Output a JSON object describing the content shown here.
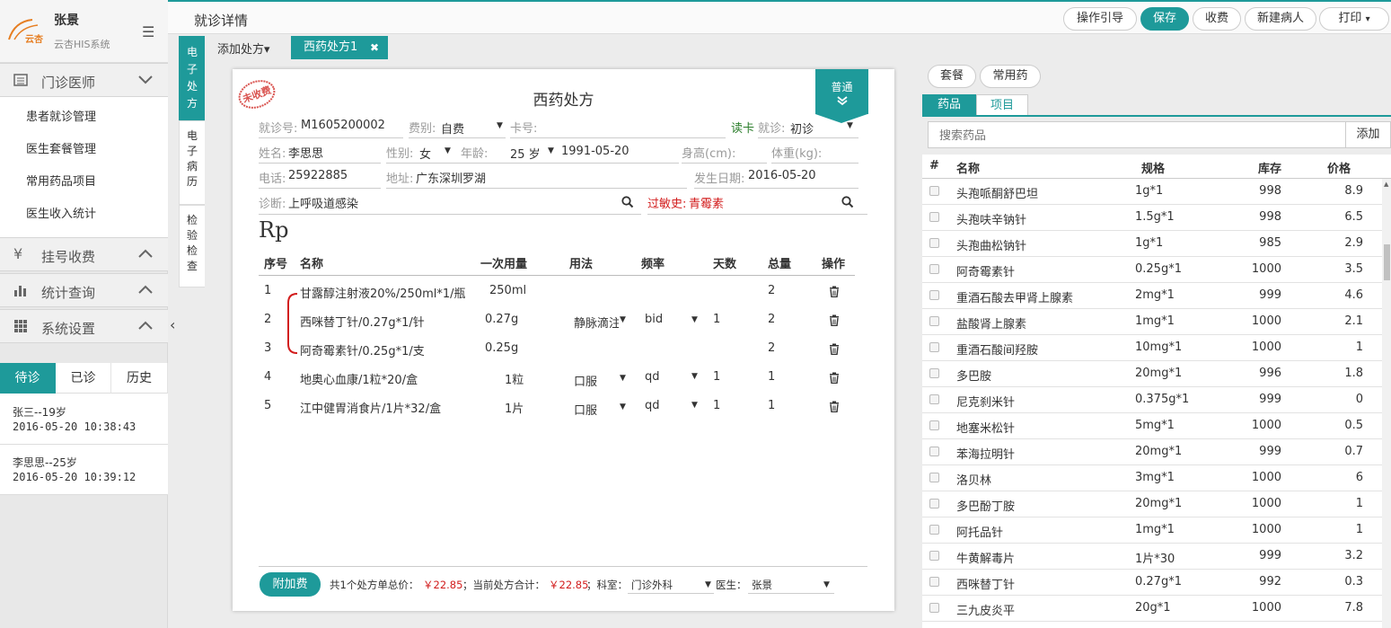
{
  "brand": {
    "user": "张景",
    "system": "云杏HIS系统",
    "logo_text": "云杏"
  },
  "nav": {
    "sections": [
      {
        "label": "门诊医师",
        "icon": "list-icon",
        "expanded": true
      },
      {
        "label": "挂号收费",
        "icon": "yen-icon",
        "expanded": false
      },
      {
        "label": "统计查询",
        "icon": "bar-chart-icon",
        "expanded": false
      },
      {
        "label": "系统设置",
        "icon": "grid-icon",
        "expanded": false
      }
    ],
    "items": [
      "患者就诊管理",
      "医生套餐管理",
      "常用药品项目",
      "医生收入统计"
    ]
  },
  "queue": {
    "tabs": [
      "待诊",
      "已诊",
      "历史"
    ],
    "patients": [
      {
        "name": "张三--19岁",
        "time": "2016-05-20 10:38:43"
      },
      {
        "name": "李思思--25岁",
        "time": "2016-05-20 10:39:12"
      }
    ]
  },
  "header": {
    "title": "就诊详情",
    "buttons": [
      "操作引导",
      "保存",
      "收费",
      "新建病人",
      "打印"
    ],
    "print_caret": "▾"
  },
  "side_tabs": [
    "电子处方",
    "电子病历",
    "检验检查"
  ],
  "rx_tabs": {
    "add": "添加处方▾",
    "current": "西药处方1",
    "close": "✖"
  },
  "rx": {
    "title": "西药处方",
    "stamp": "未收费",
    "ribbon": "普通",
    "fields": {
      "visit_no_label": "就诊号:",
      "visit_no": "M1605200002",
      "fee_label": "费别:",
      "fee": "自费",
      "card_label": "卡号:",
      "read_card": "读卡",
      "visit_label": "就诊:",
      "visit": "初诊",
      "name_label": "姓名:",
      "name": "李思思",
      "sex_label": "性别:",
      "sex": "女",
      "age_label": "年龄:",
      "age": "25 岁",
      "birth": "1991-05-20",
      "height_label": "身高(cm):",
      "weight_label": "体重(kg):",
      "phone_label": "电话:",
      "phone": "25922885",
      "address_label": "地址:",
      "address": "广东深圳罗湖",
      "date_label": "发生日期:",
      "date": "2016-05-20",
      "diag_label": "诊断:",
      "diag": "上呼吸道感染",
      "allergy_label": "过敏史:",
      "allergy": "青霉素"
    },
    "rp": "Rp",
    "columns": [
      "序号",
      "名称",
      "一次用量",
      "用法",
      "频率",
      "天数",
      "总量",
      "操作"
    ],
    "rows": [
      {
        "no": "1",
        "name": "甘露醇注射液20%/250ml*1/瓶",
        "dose": "250ml",
        "usage": "",
        "freq": "",
        "days": "",
        "total": "2"
      },
      {
        "no": "2",
        "name": "西咪替丁针/0.27g*1/针",
        "dose": "0.27g",
        "usage": "静脉滴注",
        "freq": "bid",
        "days": "1",
        "total": "2"
      },
      {
        "no": "3",
        "name": "阿奇霉素针/0.25g*1/支",
        "dose": "0.25g",
        "usage": "",
        "freq": "",
        "days": "",
        "total": "2"
      },
      {
        "no": "4",
        "name": "地奥心血康/1粒*20/盒",
        "dose": "1粒",
        "usage": "口服",
        "freq": "qd",
        "days": "1",
        "total": "1"
      },
      {
        "no": "5",
        "name": "江中健胃消食片/1片*32/盒",
        "dose": "1片",
        "usage": "口服",
        "freq": "qd",
        "days": "1",
        "total": "1"
      }
    ],
    "footer": {
      "fee_button": "附加费",
      "summary_a": "共1个处方单总价：",
      "total_a": "￥22.85",
      "summary_b": "；当前处方合计：",
      "total_b": "￥22.85",
      "dept_label": "；科室：",
      "dept": "门诊外科",
      "doctor_label": "医生：",
      "doctor": "张景"
    }
  },
  "drugs": {
    "pills": [
      "套餐",
      "常用药"
    ],
    "tabs": [
      "药品",
      "项目"
    ],
    "search_placeholder": "搜索药品",
    "add": "添加",
    "columns": [
      "#",
      "名称",
      "规格",
      "库存",
      "价格"
    ],
    "rows": [
      {
        "name": "头孢哌酮舒巴坦",
        "spec": "1g*1",
        "stock": "998",
        "price": "8.9"
      },
      {
        "name": "头孢呋辛钠针",
        "spec": "1.5g*1",
        "stock": "998",
        "price": "6.5"
      },
      {
        "name": "头孢曲松钠针",
        "spec": "1g*1",
        "stock": "985",
        "price": "2.9"
      },
      {
        "name": "阿奇霉素针",
        "spec": "0.25g*1",
        "stock": "1000",
        "price": "3.5"
      },
      {
        "name": "重酒石酸去甲肾上腺素",
        "spec": "2mg*1",
        "stock": "999",
        "price": "4.6"
      },
      {
        "name": "盐酸肾上腺素",
        "spec": "1mg*1",
        "stock": "1000",
        "price": "2.1"
      },
      {
        "name": "重酒石酸间羟胺",
        "spec": "10mg*1",
        "stock": "1000",
        "price": "1"
      },
      {
        "name": "多巴胺",
        "spec": "20mg*1",
        "stock": "996",
        "price": "1.8"
      },
      {
        "name": "尼克刹米针",
        "spec": "0.375g*1",
        "stock": "999",
        "price": "0"
      },
      {
        "name": "地塞米松针",
        "spec": "5mg*1",
        "stock": "1000",
        "price": "0.5"
      },
      {
        "name": "苯海拉明针",
        "spec": "20mg*1",
        "stock": "999",
        "price": "0.7"
      },
      {
        "name": "洛贝林",
        "spec": "3mg*1",
        "stock": "1000",
        "price": "6"
      },
      {
        "name": "多巴酚丁胺",
        "spec": "20mg*1",
        "stock": "1000",
        "price": "1"
      },
      {
        "name": "阿托品针",
        "spec": "1mg*1",
        "stock": "1000",
        "price": "1"
      },
      {
        "name": "牛黄解毒片",
        "spec": "1片*30",
        "stock": "999",
        "price": "3.2"
      },
      {
        "name": "西咪替丁针",
        "spec": "0.27g*1",
        "stock": "992",
        "price": "0.3"
      },
      {
        "name": "三九皮炎平",
        "spec": "20g*1",
        "stock": "1000",
        "price": "7.8"
      }
    ]
  },
  "colors": {
    "accent": "#1e9a9a",
    "danger": "#d21d1d"
  }
}
